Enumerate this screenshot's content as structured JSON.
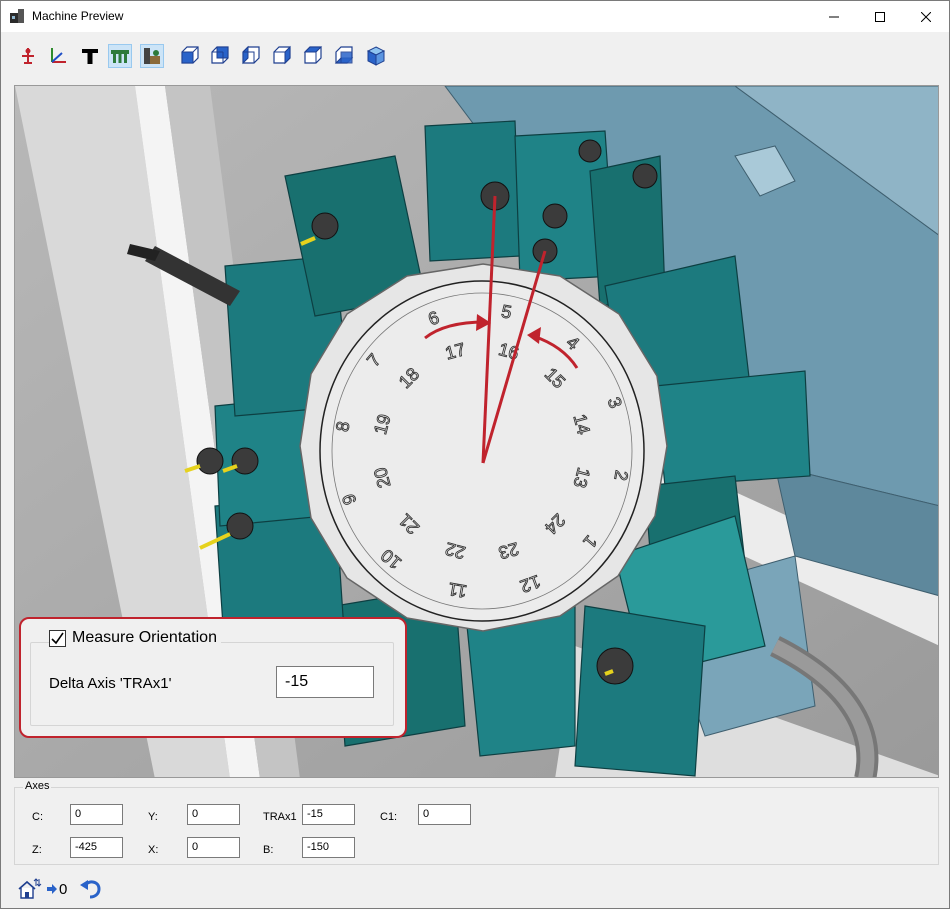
{
  "window": {
    "title": "Machine Preview"
  },
  "toolbar": {
    "buttons": [
      {
        "name": "origin-marker-icon",
        "active": false
      },
      {
        "name": "axes-icon",
        "active": false
      },
      {
        "name": "text-icon",
        "active": false
      },
      {
        "name": "tool-holders-icon",
        "active": true
      },
      {
        "name": "machine-table-icon",
        "active": true
      },
      {
        "name": "view-front-icon",
        "active": false
      },
      {
        "name": "view-back-icon",
        "active": false
      },
      {
        "name": "view-left-icon",
        "active": false
      },
      {
        "name": "view-right-icon",
        "active": false
      },
      {
        "name": "view-top-icon",
        "active": false
      },
      {
        "name": "view-bottom-icon",
        "active": false
      },
      {
        "name": "view-iso-icon",
        "active": false
      }
    ]
  },
  "turret": {
    "outer_numbers": [
      "5",
      "4",
      "3",
      "2",
      "1",
      "12",
      "11",
      "10",
      "9",
      "8",
      "7",
      "6"
    ],
    "inner_numbers": [
      "16",
      "15",
      "14",
      "13",
      "24",
      "23",
      "22",
      "21",
      "20",
      "19",
      "18",
      "17"
    ]
  },
  "measure": {
    "checked": true,
    "checkbox_label": "Measure Orientation",
    "delta_label": "Delta Axis 'TRAx1'",
    "delta_value": "-15"
  },
  "axes": {
    "title": "Axes",
    "fields": [
      {
        "label": "C:",
        "value": "0"
      },
      {
        "label": "Y:",
        "value": "0"
      },
      {
        "label": "TRAx1",
        "value": "-15"
      },
      {
        "label": "C1:",
        "value": "0"
      },
      {
        "label": "Z:",
        "value": "-425"
      },
      {
        "label": "X:",
        "value": "0"
      },
      {
        "label": "B:",
        "value": "-150"
      }
    ]
  },
  "bottom": {
    "zero_label": "0"
  },
  "colors": {
    "accent_red": "#c0232d",
    "tool_teal": "#1c7a7e",
    "housing_blue": "#6e9aaf"
  }
}
